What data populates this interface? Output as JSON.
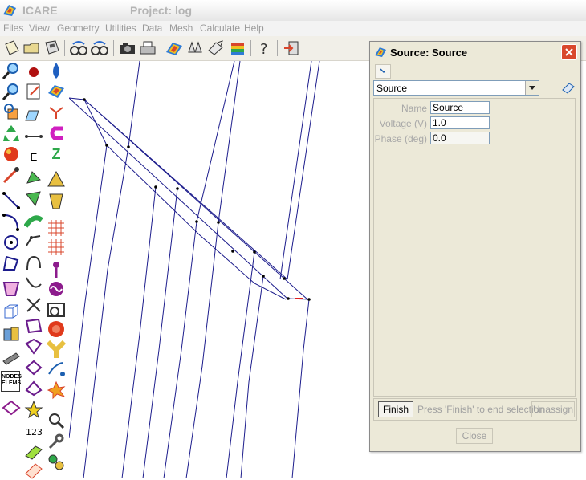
{
  "window": {
    "app_name": "ICARE",
    "project_title": "Project: log"
  },
  "menu": [
    "Files",
    "View",
    "Geometry",
    "Utilities",
    "Data",
    "Mesh",
    "Calculate",
    "Help"
  ],
  "toolbar_icons": [
    "new-icon",
    "open-icon",
    "save-icon",
    "zoom-link-icon",
    "zoom-link-alt-icon",
    "camera-icon",
    "print-icon",
    "rainbow-icon",
    "pair-icon",
    "edit-icon",
    "layers-icon",
    "help-icon",
    "exit-icon"
  ],
  "palette": {
    "nodes_elems_label": "NODES ELEMS",
    "z_label": "Z",
    "e_label": "E"
  },
  "dialog": {
    "title": "Source: Source",
    "selected_source": "Source",
    "fields": [
      {
        "label": "Name",
        "value": "Source"
      },
      {
        "label": "Voltage (V)",
        "value": "1.0"
      },
      {
        "label": "Phase (deg)",
        "value": "0.0"
      }
    ],
    "finish_label": "Finish",
    "hint": "Press 'Finish' to end selection",
    "unassign_label": "Unassign",
    "close_label": "Close"
  },
  "colors": {
    "wire": "#1c1c8c",
    "accent": "#d9482c"
  }
}
